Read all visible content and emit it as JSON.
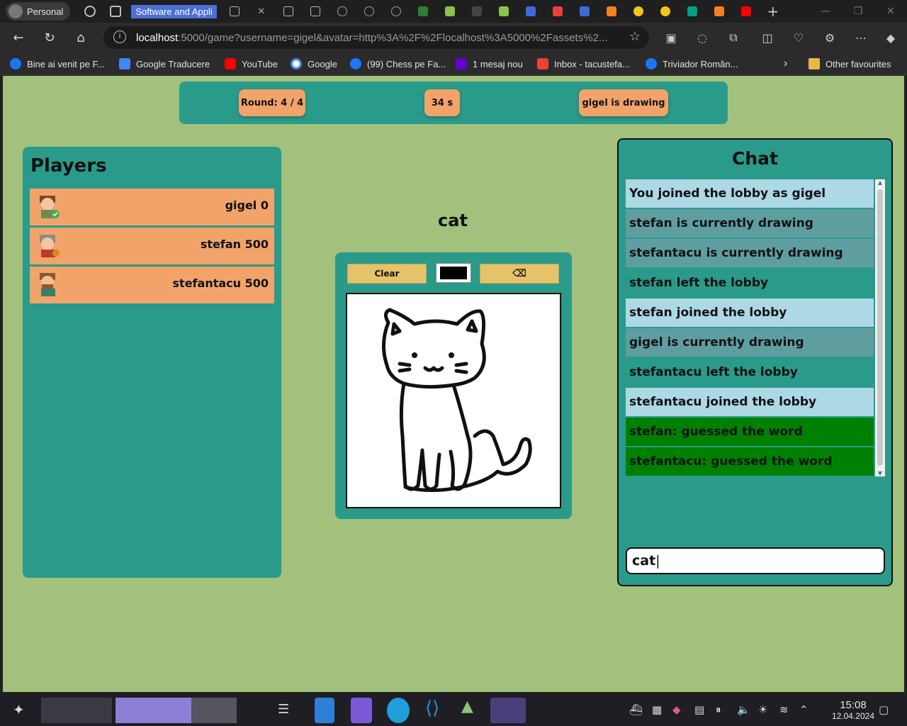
{
  "browser": {
    "profile_label": "Personal",
    "active_tab_title": "Software and Appli",
    "url_host": "localhost",
    "url_rest": ":5000/game?username=gigel&avatar=http%3A%2F%2Flocalhost%3A5000%2Fassets%2...",
    "bookmarks": [
      {
        "label": "Bine ai venit pe F...",
        "color": "#1877f2"
      },
      {
        "label": "Google Traducere",
        "color": "#4285f4"
      },
      {
        "label": "YouTube",
        "color": "#ff0000"
      },
      {
        "label": "Google",
        "color": "#ffffff"
      },
      {
        "label": "(99) Chess pe Fa...",
        "color": "#1877f2"
      },
      {
        "label": "1 mesaj nou",
        "color": "#6001d2"
      },
      {
        "label": "Inbox - tacustefa...",
        "color": "#ea4335"
      },
      {
        "label": "Triviador Român...",
        "color": "#1877f2"
      }
    ],
    "other_favourites": "Other favourites"
  },
  "game": {
    "round_label": "Round: 4 / 4",
    "timer_label": "34 s",
    "drawer_label": "gigel is drawing",
    "word": "cat",
    "players_title": "Players",
    "players": [
      {
        "name": "gigel",
        "score": "0",
        "label": "gigel 0"
      },
      {
        "name": "stefan",
        "score": "500",
        "label": "stefan 500"
      },
      {
        "name": "stefantacu",
        "score": "500",
        "label": "stefantacu 500"
      }
    ],
    "clear_label": "Clear",
    "eraser_icon": "eraser-icon",
    "chat_title": "Chat",
    "messages": [
      {
        "text": "You joined the lobby as gigel",
        "bg": "#add8e6"
      },
      {
        "text": "stefan is currently drawing",
        "bg": "#5f9ea0"
      },
      {
        "text": "stefantacu is currently drawing",
        "bg": "#5f9ea0"
      },
      {
        "text": "stefan left the lobby",
        "bg": "#2a9a8b"
      },
      {
        "text": "stefan joined the lobby",
        "bg": "#add8e6"
      },
      {
        "text": "gigel is currently drawing",
        "bg": "#5f9ea0"
      },
      {
        "text": "stefantacu left the lobby",
        "bg": "#2a9a8b"
      },
      {
        "text": "stefantacu joined the lobby",
        "bg": "#add8e6"
      },
      {
        "text": "stefan: guessed the word",
        "bg": "#008000"
      },
      {
        "text": "stefantacu: guessed the word",
        "bg": "#008000"
      }
    ],
    "chat_input_value": "cat"
  },
  "taskbar": {
    "time": "15:08",
    "date": "12.04.2024"
  }
}
